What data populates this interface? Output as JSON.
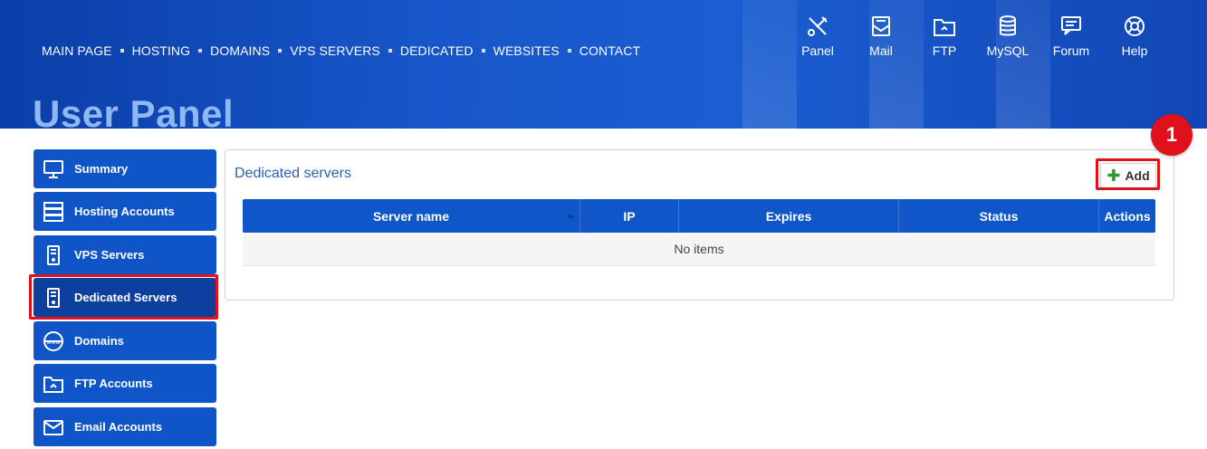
{
  "nav": {
    "items": [
      "MAIN PAGE",
      "HOSTING",
      "DOMAINS",
      "VPS SERVERS",
      "DEDICATED",
      "WEBSITES",
      "CONTACT"
    ]
  },
  "quick_links": [
    {
      "label": "Panel",
      "icon": "tools-icon"
    },
    {
      "label": "Mail",
      "icon": "mail-icon"
    },
    {
      "label": "FTP",
      "icon": "ftp-folder-icon"
    },
    {
      "label": "MySQL",
      "icon": "database-icon"
    },
    {
      "label": "Forum",
      "icon": "forum-icon"
    },
    {
      "label": "Help",
      "icon": "lifebuoy-icon"
    }
  ],
  "page_title": "User Panel",
  "sidebar": {
    "items": [
      {
        "label": "Summary",
        "icon": "monitor-icon"
      },
      {
        "label": "Hosting Accounts",
        "icon": "server-stack-icon"
      },
      {
        "label": "VPS Servers",
        "icon": "server-tower-icon"
      },
      {
        "label": "Dedicated Servers",
        "icon": "server-tower-icon",
        "active": true
      },
      {
        "label": "Domains",
        "icon": "www-globe-icon"
      },
      {
        "label": "FTP Accounts",
        "icon": "ftp-folder-icon"
      },
      {
        "label": "Email Accounts",
        "icon": "email-icon"
      }
    ]
  },
  "main": {
    "title": "Dedicated servers",
    "add_label": "Add",
    "badge": "1",
    "table": {
      "columns": [
        "Server name",
        "IP",
        "Expires",
        "Status",
        "Actions"
      ],
      "empty_text": "No items"
    }
  },
  "colors": {
    "header_blue": "#1756c9",
    "sidebar_blue": "#1055c8",
    "active_blue": "#0c3f9e",
    "highlight_red": "#e0111b",
    "title_light_blue": "#8fb7f2"
  }
}
